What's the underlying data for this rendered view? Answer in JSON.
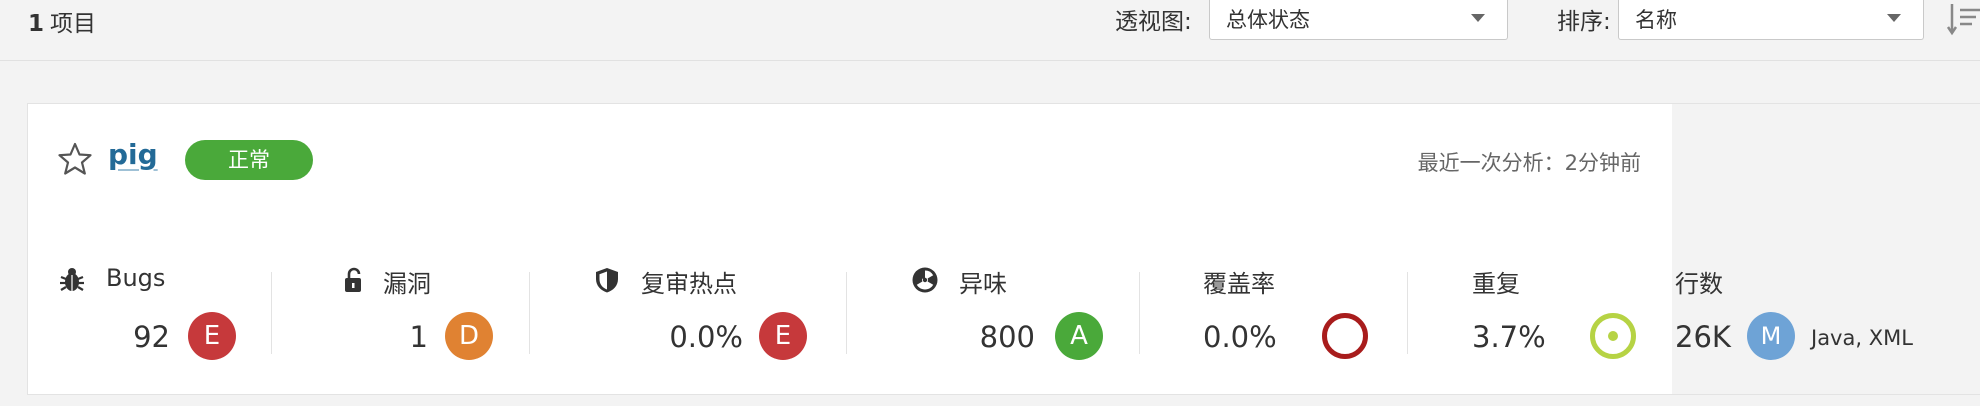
{
  "toolbar": {
    "count_number": "1",
    "count_label": "项目",
    "perspective_label": "透视图:",
    "perspective_value": "总体状态",
    "sort_label": "排序:",
    "sort_value": "名称"
  },
  "project": {
    "name": "pig",
    "status": "正常",
    "last_analysis": "最近一次分析：2分钟前",
    "metrics": {
      "bugs": {
        "label": "Bugs",
        "value": "92",
        "rating": "E",
        "icon": "bug-icon"
      },
      "vulnerabilities": {
        "label": "漏洞",
        "value": "1",
        "rating": "D",
        "icon": "lock-icon"
      },
      "hotspots": {
        "label": "复审热点",
        "value": "0.0%",
        "rating": "E",
        "icon": "shield-icon"
      },
      "code_smells": {
        "label": "异味",
        "value": "800",
        "rating": "A",
        "icon": "radiation-icon"
      },
      "coverage": {
        "label": "覆盖率",
        "value": "0.0%",
        "icon": "coverage-ring-icon"
      },
      "duplications": {
        "label": "重复",
        "value": "3.7%",
        "icon": "duplication-ring-icon"
      },
      "lines": {
        "label": "行数",
        "value": "26K",
        "size": "M",
        "languages": "Java, XML"
      }
    }
  },
  "colors": {
    "rating_e": "#c6393b",
    "rating_d": "#e08232",
    "rating_a": "#4aa93a",
    "size_badge": "#6ea3d6",
    "status_ok": "#4aa93a",
    "coverage_ring": "#a81c1c",
    "duplication_ring": "#b6d344"
  }
}
